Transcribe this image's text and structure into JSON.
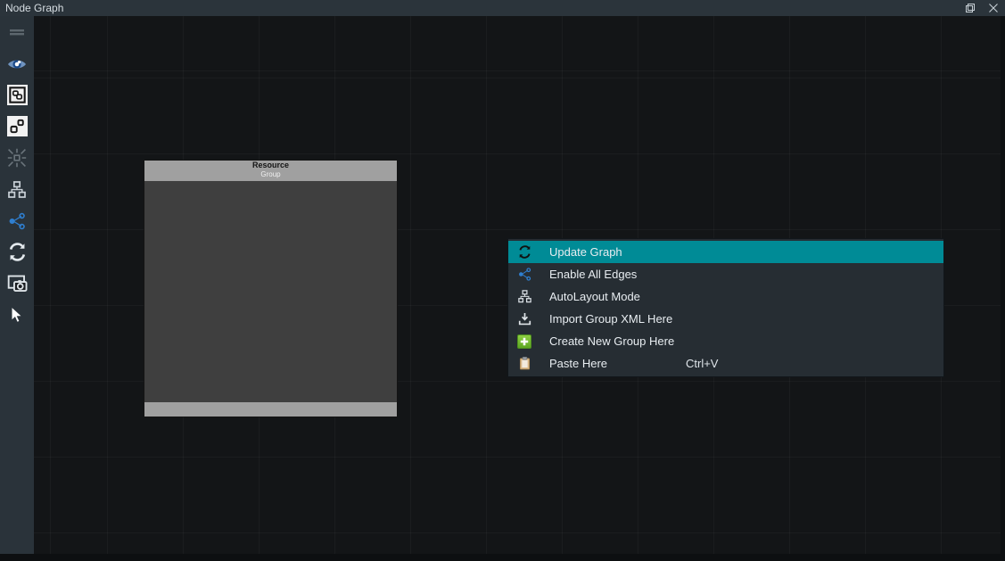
{
  "window": {
    "title": "Node Graph",
    "buttons": [
      {
        "name": "restore-button",
        "glyph": "restore"
      },
      {
        "name": "close-button",
        "glyph": "close"
      }
    ]
  },
  "sidebar": {
    "items": [
      {
        "icon": "hamburger-menu-icon",
        "label": "Menu"
      },
      {
        "icon": "eye-icon",
        "label": "Show / Hide"
      },
      {
        "icon": "duplicate-nodes-icon",
        "label": "Duplicate"
      },
      {
        "icon": "nodes-icon",
        "label": "Nodes"
      },
      {
        "icon": "collapse-icon",
        "label": "Collapse"
      },
      {
        "icon": "hierarchy-icon",
        "label": "Hierarchy"
      },
      {
        "icon": "share-edges-icon",
        "label": "Edges"
      },
      {
        "icon": "refresh-icon",
        "label": "Refresh"
      },
      {
        "icon": "screenshot-camera-icon",
        "label": "Screenshot"
      },
      {
        "icon": "cursor-arrow-icon",
        "label": "Select"
      }
    ]
  },
  "canvas": {
    "group_node": {
      "title": "Resource",
      "subtitle": "Group"
    }
  },
  "context_menu": {
    "items": [
      {
        "label": "Update Graph",
        "shortcut": "",
        "icon": "refresh-icon",
        "selected": true
      },
      {
        "label": "Enable All Edges",
        "shortcut": "",
        "icon": "share-edges-icon",
        "selected": false
      },
      {
        "label": "AutoLayout Mode",
        "shortcut": "",
        "icon": "hierarchy-icon",
        "selected": false
      },
      {
        "label": "Import Group XML Here",
        "shortcut": "",
        "icon": "import-icon",
        "selected": false
      },
      {
        "label": "Create New Group Here",
        "shortcut": "",
        "icon": "plus-square-icon",
        "selected": false
      },
      {
        "label": "Paste Here",
        "shortcut": "Ctrl+V",
        "icon": "clipboard-icon",
        "selected": false
      }
    ]
  },
  "colors": {
    "titlebar_bg": "#2b343b",
    "sidebar_bg": "#2a333a",
    "canvas_bg": "#131517",
    "menu_bg": "#262d33",
    "menu_highlight": "#008b96",
    "node_header": "#a0a0a0",
    "node_body": "#3f3f3f",
    "accent_blue": "#2f7fd0",
    "accent_green": "#6fb82c"
  }
}
